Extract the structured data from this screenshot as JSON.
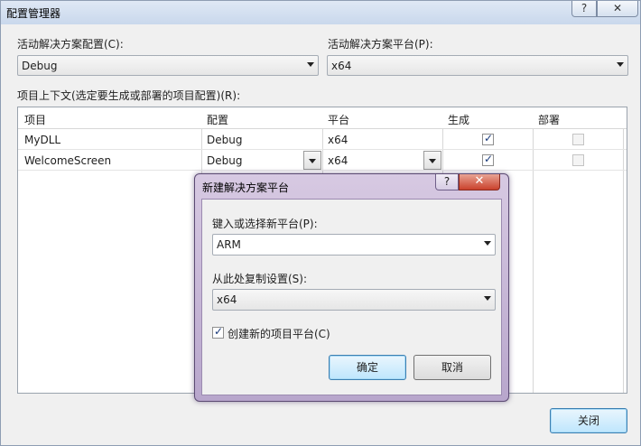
{
  "window": {
    "title": "配置管理器",
    "help_glyph": "?",
    "close_glyph": "✕"
  },
  "config": {
    "active_config_label": "活动解决方案配置(C):",
    "active_config_value": "Debug",
    "active_platform_label": "活动解决方案平台(P):",
    "active_platform_value": "x64",
    "context_label": "项目上下文(选定要生成或部署的项目配置)(R):"
  },
  "grid": {
    "headers": [
      "项目",
      "配置",
      "平台",
      "生成",
      "部署"
    ],
    "rows": [
      {
        "project": "MyDLL",
        "config": "Debug",
        "platform": "x64",
        "build": true,
        "deploy": false
      },
      {
        "project": "WelcomeScreen",
        "config": "Debug",
        "platform": "x64",
        "build": true,
        "deploy": false
      }
    ]
  },
  "close_button": "关闭",
  "dialog": {
    "title": "新建解决方案平台",
    "help_glyph": "?",
    "close_glyph": "✕",
    "new_platform_label": "键入或选择新平台(P):",
    "new_platform_value": "ARM",
    "copy_from_label": "从此处复制设置(S):",
    "copy_from_value": "x64",
    "create_project_platforms_label": "创建新的项目平台(C)",
    "create_project_platforms_checked": true,
    "ok_button": "确定",
    "cancel_button": "取消"
  }
}
